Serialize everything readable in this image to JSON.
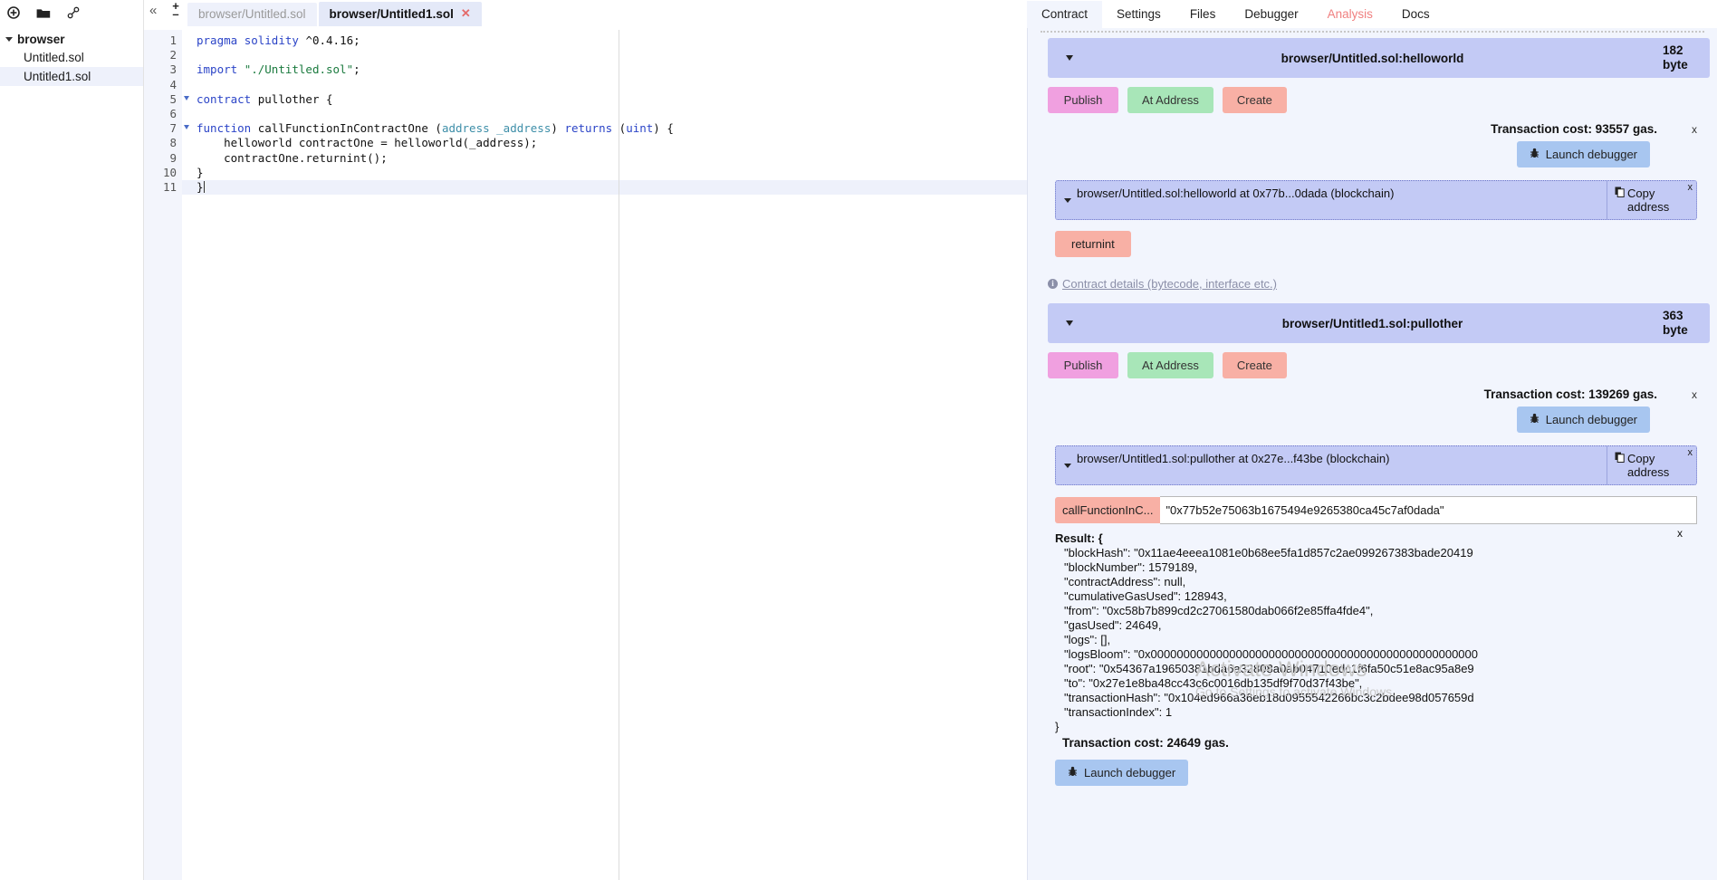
{
  "file_explorer": {
    "toolbar_icons": [
      "create-file-icon",
      "open-folder-icon",
      "link-icon"
    ],
    "root_label": "browser",
    "files": [
      {
        "name": "Untitled.sol",
        "selected": false
      },
      {
        "name": "Untitled1.sol",
        "selected": true
      }
    ]
  },
  "editor": {
    "collapse_glyph": "«",
    "zoom_in": "+",
    "zoom_out": "–",
    "tabs": [
      {
        "label": "browser/Untitled.sol",
        "active": false
      },
      {
        "label": "browser/Untitled1.sol",
        "active": true,
        "close": "✕"
      }
    ],
    "line_numbers": [
      "1",
      "2",
      "3",
      "4",
      "5",
      "6",
      "7",
      "8",
      "9",
      "10",
      "11"
    ],
    "code": [
      "pragma solidity ^0.4.16;",
      "",
      "import \"./Untitled.sol\";",
      "",
      "contract pullother {",
      "",
      "function callFunctionInContractOne (address _address) returns (uint) {",
      "    helloworld contractOne = helloworld(_address);",
      "    contractOne.returnint();",
      "}",
      "}"
    ]
  },
  "right_panel": {
    "expand_glyph": "»",
    "tabs": [
      {
        "label": "Contract",
        "active": true,
        "alert": false
      },
      {
        "label": "Settings",
        "active": false,
        "alert": false
      },
      {
        "label": "Files",
        "active": false,
        "alert": false
      },
      {
        "label": "Debugger",
        "active": false,
        "alert": false
      },
      {
        "label": "Analysis",
        "active": false,
        "alert": true
      },
      {
        "label": "Docs",
        "active": false,
        "alert": false
      }
    ],
    "buttons": {
      "publish": "Publish",
      "at_address": "At Address",
      "create": "Create",
      "launch_debugger": "Launch debugger",
      "copy_address": "Copy address",
      "close_x": "x",
      "instance_close_x": "x"
    },
    "contract_details_link": "Contract details (bytecode, interface etc.)",
    "contracts": [
      {
        "title": "browser/Untitled.sol:helloworld",
        "size": "182 byte",
        "transaction_cost": "Transaction cost: 93557 gas.",
        "instance_label": "browser/Untitled.sol:helloworld at 0x77b...0dada (blockchain)",
        "functions": [
          {
            "label": "returnint"
          }
        ]
      },
      {
        "title": "browser/Untitled1.sol:pullother",
        "size": "363 byte",
        "transaction_cost": "Transaction cost: 139269 gas.",
        "instance_label": "browser/Untitled1.sol:pullother at 0x27e...f43be (blockchain)",
        "functions": [
          {
            "label": "callFunctionInC...",
            "input_value": "\"0x77b52e75063b1675494e9265380ca45c7af0dada\""
          }
        ]
      }
    ],
    "result": {
      "title": "Result: {",
      "lines": [
        "\"blockHash\": \"0x11ae4eeea1081e0b68ee5fa1d857c2ae099267383bade20419",
        "\"blockNumber\": 1579189,",
        "\"contractAddress\": null,",
        "\"cumulativeGasUsed\": 128943,",
        "\"from\": \"0xc58b7b899cd2c27061580dab066f2e85ffa4fde4\",",
        "\"gasUsed\": 24649,",
        "\"logs\": [],",
        "\"logsBloom\": \"0x00000000000000000000000000000000000000000000000000",
        "\"root\": \"0x54367a19650381bda6a32808a0ab04710edc1f6fa50c51e8ac95a8e9",
        "\"to\": \"0x27e1e8ba48cc43c6c0016db135df9f70d37f43be\",",
        "\"transactionHash\": \"0x104ed966a36eb18d0955542266bc3c2bdee98d057659d",
        "\"transactionIndex\": 1"
      ],
      "closing": "}",
      "transaction_cost": "Transaction cost: 24649 gas.",
      "close_x": "x"
    }
  },
  "watermark": {
    "title": "Activate Windows",
    "subtitle": "Go to Settings to activate Windows."
  },
  "colors": {
    "publish": "#f0a0e0",
    "at_address": "#a8e6b8",
    "create": "#f8b0a5",
    "debug": "#a8c6f0",
    "contract_header": "#c3caf5",
    "panel_bg": "#f2f5fd",
    "alert_tab": "#f08080"
  }
}
